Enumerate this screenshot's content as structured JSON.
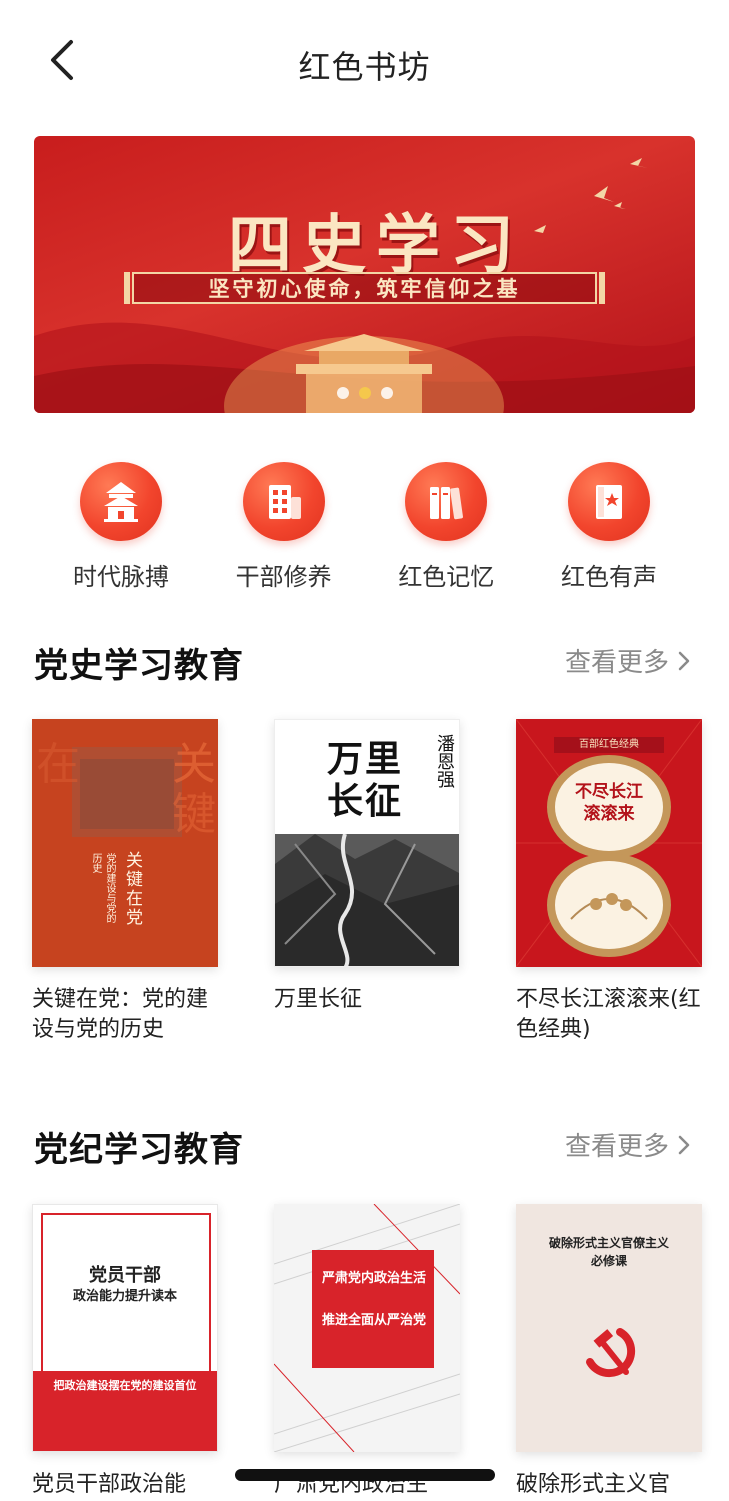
{
  "header": {
    "title": "红色书坊",
    "back_icon": "chevron-left-icon"
  },
  "banner": {
    "title": "四史学习",
    "subtitle": "坚守初心使命，筑牢信仰之基",
    "slides": 3,
    "active_slide": 2
  },
  "categories": [
    {
      "label": "时代脉搏",
      "icon": "pavilion-icon"
    },
    {
      "label": "干部修养",
      "icon": "building-icon"
    },
    {
      "label": "红色记忆",
      "icon": "books-icon"
    },
    {
      "label": "红色有声",
      "icon": "audio-book-icon"
    }
  ],
  "sections": [
    {
      "title": "党史学习教育",
      "more_label": "查看更多",
      "books": [
        {
          "title": "关键在党：党的建设与党的历史",
          "cover_text": "关键在党",
          "cover_sub": "党的建设与党的历史"
        },
        {
          "title": "万里长征",
          "cover_text": "万里长征",
          "cover_author": "潘恩强"
        },
        {
          "title": "不尽长江滚滚来(红色经典)",
          "cover_text": "不尽长江滚滚来",
          "cover_badge": "百部红色经典"
        }
      ]
    },
    {
      "title": "党纪学习教育",
      "more_label": "查看更多",
      "books": [
        {
          "title": "党员干部政治能",
          "cover_text": "党员干部",
          "cover_sub": "政治能力提升读本",
          "cover_band": "把政治建设摆在党的建设首位"
        },
        {
          "title": "广肃党内政治生",
          "cover_text": "严肃党内政治生活",
          "cover_sub": "推进全面从严治党"
        },
        {
          "title": "破除形式主义官",
          "cover_text": "破除形式主义官僚主义",
          "cover_sub": "必修课"
        }
      ]
    }
  ],
  "colors": {
    "brand_red": "#e23a2a",
    "banner_red": "#c81d1d",
    "text_gray": "#8a8a8a"
  }
}
